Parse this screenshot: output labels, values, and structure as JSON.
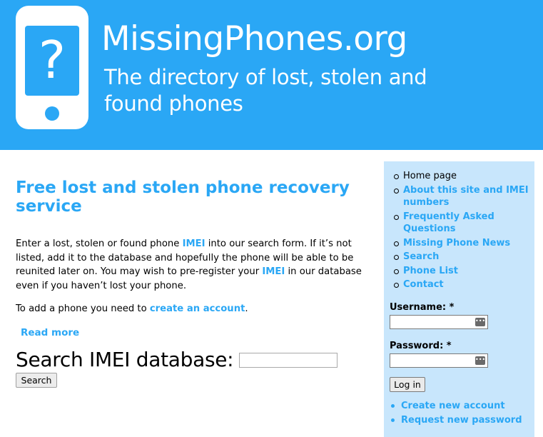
{
  "header": {
    "site_name": "MissingPhones.org",
    "slogan": "The directory of lost, stolen and found phones",
    "logo_glyph": "?",
    "logo_icon": "phone-question-icon",
    "brand_color": "#2aa7f5"
  },
  "main": {
    "title": "Free lost and stolen phone recovery service",
    "intro": {
      "t1": "Enter a lost, stolen or found phone ",
      "imei1": "IMEI",
      "t2": " into our search form. If it’s not listed, add it to the database and hopefully the phone will be able to be reunited later on. You may wish to pre-register your ",
      "imei2": "IMEI",
      "t3": " in our database even if you haven’t lost your phone."
    },
    "add": {
      "t1": "To add a phone you need to ",
      "link": "create an account",
      "t2": "."
    },
    "read_more": "Read more",
    "search": {
      "title": "Search IMEI database:",
      "value": "",
      "button": "Search"
    }
  },
  "sidebar": {
    "nav": [
      {
        "label": "Home page",
        "current": true
      },
      {
        "label": "About this site and IMEI numbers"
      },
      {
        "label": "Frequently Asked Questions"
      },
      {
        "label": "Missing Phone News"
      },
      {
        "label": "Search"
      },
      {
        "label": "Phone List"
      },
      {
        "label": "Contact"
      }
    ],
    "username_label": "Username: *",
    "username_value": "",
    "password_label": "Password: *",
    "password_value": "",
    "field_icon": "password-manager-icon",
    "login_button": "Log in",
    "links": [
      "Create new account",
      "Request new password"
    ],
    "background": "#c8e6fc"
  }
}
